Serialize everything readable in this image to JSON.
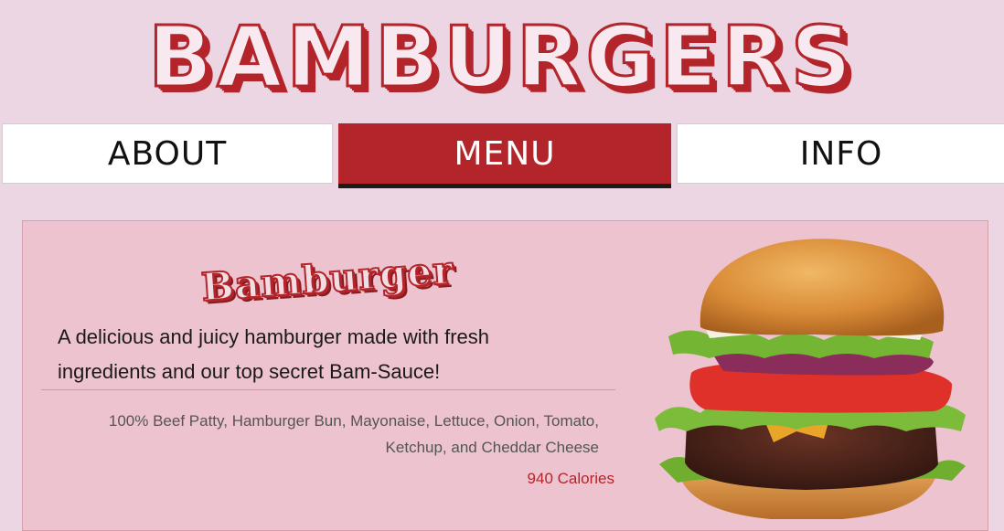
{
  "brand": {
    "logo_text": "BAMBURGERS"
  },
  "nav": {
    "items": [
      {
        "label": "ABOUT"
      },
      {
        "label": "MENU"
      },
      {
        "label": "INFO"
      }
    ],
    "active": "MENU"
  },
  "menu_item": {
    "name": "Bamburger",
    "description": "A delicious and juicy hamburger made with fresh ingredients and our top secret Bam-Sauce!",
    "ingredients": "100% Beef Patty, Hamburger Bun, Mayonaise, Lettuce, Onion, Tomato, Ketchup, and Cheddar Cheese",
    "calories": "940 Calories"
  },
  "colors": {
    "background": "#edd6e3",
    "accent": "#b3252a",
    "card": "#ecc3ce"
  },
  "icons": {
    "burger_image": "hamburger-photo"
  }
}
